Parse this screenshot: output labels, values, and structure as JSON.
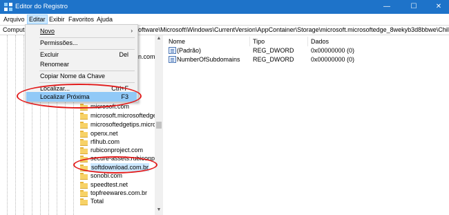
{
  "window": {
    "title": "Editor do Registro",
    "minimize_glyph": "—",
    "maximize_glyph": "☐",
    "close_glyph": "✕",
    "icon": "registry-app-icon"
  },
  "menubar": {
    "items": [
      "Arquivo",
      "Editar",
      "Exibir",
      "Favoritos",
      "Ajuda"
    ],
    "active_index": 1
  },
  "address": {
    "left": "Computa",
    "right": "oftware\\Microsoft\\Windows\\CurrentVersion\\AppContainer\\Storage\\microsoft.microsoftedge_8wekyb3d8bbwe\\Children\\00"
  },
  "dropdown": {
    "items": [
      {
        "label": "Novo",
        "shortcut": "",
        "arrow": "›"
      },
      {
        "label": "Permissões...",
        "shortcut": "",
        "arrow": ""
      },
      {
        "label": "Excluir",
        "shortcut": "Del",
        "arrow": ""
      },
      {
        "label": "Renomear",
        "shortcut": "",
        "arrow": ""
      },
      {
        "label": "Copiar Nome da Chave",
        "shortcut": "",
        "arrow": ""
      },
      {
        "label": "Localizar...",
        "shortcut": "Ctrl+F",
        "arrow": ""
      },
      {
        "label": "Localizar Próxima",
        "shortcut": "F3",
        "arrow": ""
      }
    ],
    "hover_index": 6
  },
  "tree": {
    "partial_text": "n.com",
    "items": [
      "microsoft.com",
      "microsoft.microsoftedge",
      "microsoftedgetips.micros",
      "openx.net",
      "rfihub.com",
      "rubiconproject.com",
      "secure-assets.rubiconproj",
      "softdownload.com.br",
      "sonobi.com",
      "speedtest.net",
      "topfreewares.com.br",
      "Total"
    ],
    "selected_index": 7
  },
  "list": {
    "columns": [
      "Nome",
      "Tipo",
      "Dados"
    ],
    "rows": [
      {
        "name": "(Padrão)",
        "type": "REG_DWORD",
        "data": "0x00000000 (0)"
      },
      {
        "name": "NumberOfSubdomains",
        "type": "REG_DWORD",
        "data": "0x00000000 (0)"
      }
    ]
  },
  "colors": {
    "titlebar": "#1e73c9",
    "menu_highlight": "#91c9f7",
    "selection": "#cce8ff",
    "annotation": "#e21b1b",
    "folder": "#f7d267"
  }
}
